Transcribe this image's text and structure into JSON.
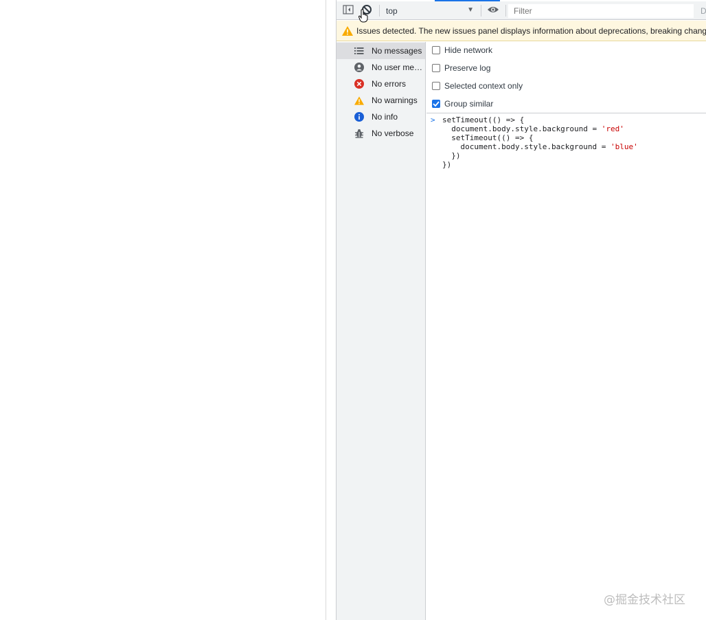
{
  "toolbar": {
    "context_label": "top",
    "filter_placeholder": "Filter",
    "tail_text": "D"
  },
  "issues_bar": {
    "text": "Issues detected. The new issues panel displays information about deprecations, breaking chang"
  },
  "sidebar": {
    "items": [
      {
        "label": "No messages",
        "icon": "list-icon",
        "selected": true
      },
      {
        "label": "No user me…",
        "icon": "user-icon",
        "selected": false
      },
      {
        "label": "No errors",
        "icon": "error-icon",
        "selected": false
      },
      {
        "label": "No warnings",
        "icon": "warning-icon",
        "selected": false
      },
      {
        "label": "No info",
        "icon": "info-icon",
        "selected": false
      },
      {
        "label": "No verbose",
        "icon": "bug-icon",
        "selected": false
      }
    ]
  },
  "settings": {
    "hide_network": {
      "label": "Hide network",
      "checked": false
    },
    "preserve_log": {
      "label": "Preserve log",
      "checked": false
    },
    "selected_context_only": {
      "label": "Selected context only",
      "checked": false
    },
    "group_similar": {
      "label": "Group similar",
      "checked": true
    }
  },
  "console": {
    "lines": [
      "setTimeout(() => {",
      "  document.body.style.background = ",
      "'red'",
      "  setTimeout(() => {",
      "    document.body.style.background = ",
      "'blue'",
      "  })",
      "})"
    ]
  },
  "watermark": "@掘金技术社区",
  "colors": {
    "accent": "#1a73e8",
    "warning_bg": "#fef7e0",
    "error": "#d93025",
    "warning": "#f9ab00",
    "string": "#c80000"
  }
}
